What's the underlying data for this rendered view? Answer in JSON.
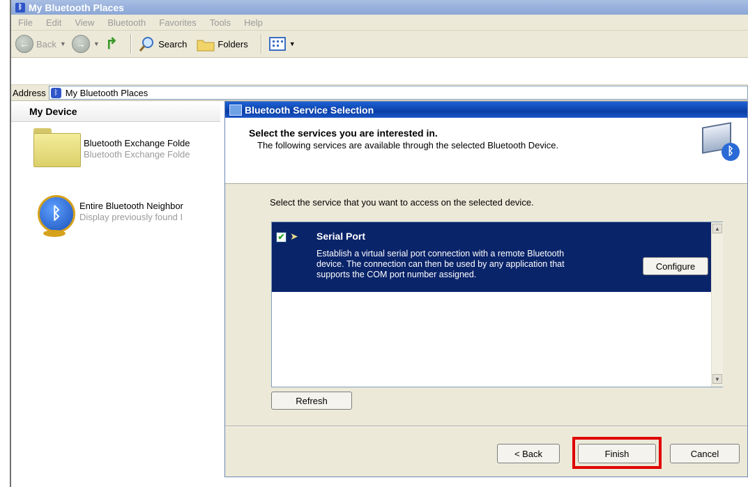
{
  "window": {
    "title": "My Bluetooth Places",
    "title_icon": "bluetooth-icon"
  },
  "menu": [
    "File",
    "Edit",
    "View",
    "Bluetooth",
    "Favorites",
    "Tools",
    "Help"
  ],
  "toolbar": {
    "back_label": "Back",
    "search_label": "Search",
    "folders_label": "Folders"
  },
  "address": {
    "label": "Address",
    "value": "My Bluetooth Places"
  },
  "left_pane": {
    "header": "My Device",
    "items": [
      {
        "name": "Bluetooth Exchange Folde",
        "subtitle": "Bluetooth Exchange Folde",
        "icon": "folder-icon"
      },
      {
        "name": "Entire Bluetooth Neighbor",
        "subtitle": "Display previously found I",
        "icon": "bluetooth-globe-icon"
      }
    ]
  },
  "dialog": {
    "title": "Bluetooth Service Selection",
    "heading": "Select the services you are interested in.",
    "subheading": "The following services are available through the selected Bluetooth Device.",
    "instruction": "Select the service that you want to access on the selected device.",
    "service": {
      "name": "Serial Port",
      "checked": true,
      "description": "Establish a virtual serial port connection with a remote Bluetooth device. The connection can then be used by any application that supports the COM port number assigned.",
      "configure_label": "Configure"
    },
    "refresh_label": "Refresh",
    "back_label": "< Back",
    "finish_label": "Finish",
    "cancel_label": "Cancel"
  },
  "colors": {
    "selection": "#0a246a",
    "highlight": "#e00000",
    "dialog_title": "#0a3ea7"
  }
}
